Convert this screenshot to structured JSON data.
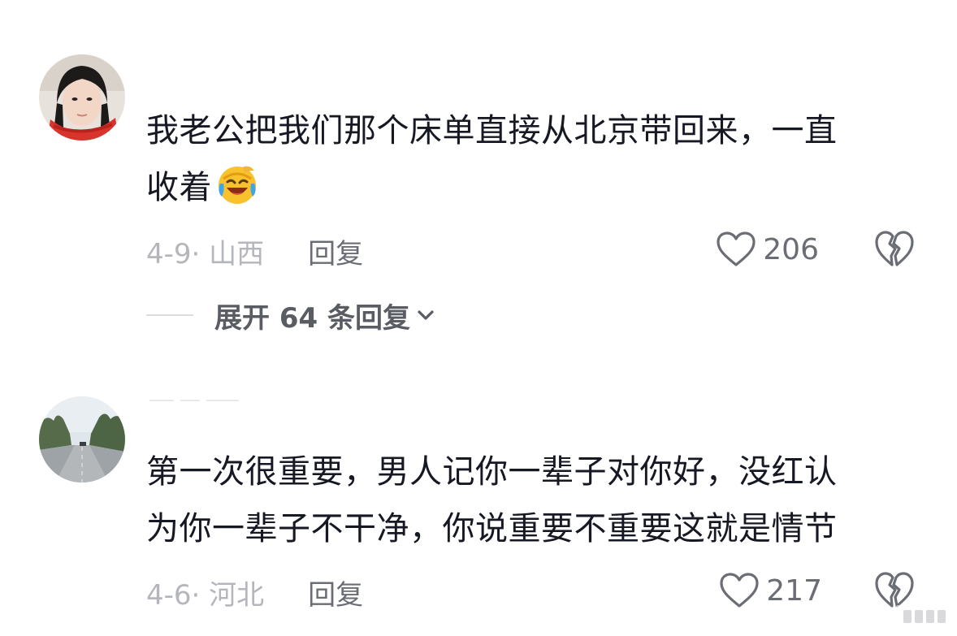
{
  "comments": [
    {
      "text_line1": "我老公把我们那个床单直接从北京带回来，一直",
      "text_line2": "收着",
      "emoji": "laughing-crying-emoji",
      "time_location": "4-9· 山西",
      "reply_label": "回复",
      "like_count": "206",
      "expand_label": "展开 64 条回复"
    },
    {
      "text_line1": "第一次很重要，男人记你一辈子对你好，没红认",
      "text_line2": "为你一辈子不干净，你说重要不重要这就是情节",
      "time_location": "4-6· 河北",
      "reply_label": "回复",
      "like_count": "217"
    }
  ],
  "icons": {
    "like": "heart-outline-icon",
    "dislike": "broken-heart-icon",
    "expand": "chevron-down-icon"
  },
  "colors": {
    "primary_text": "#161823",
    "meta_text": "#b4b6bc",
    "action_text": "#6b6d75"
  }
}
